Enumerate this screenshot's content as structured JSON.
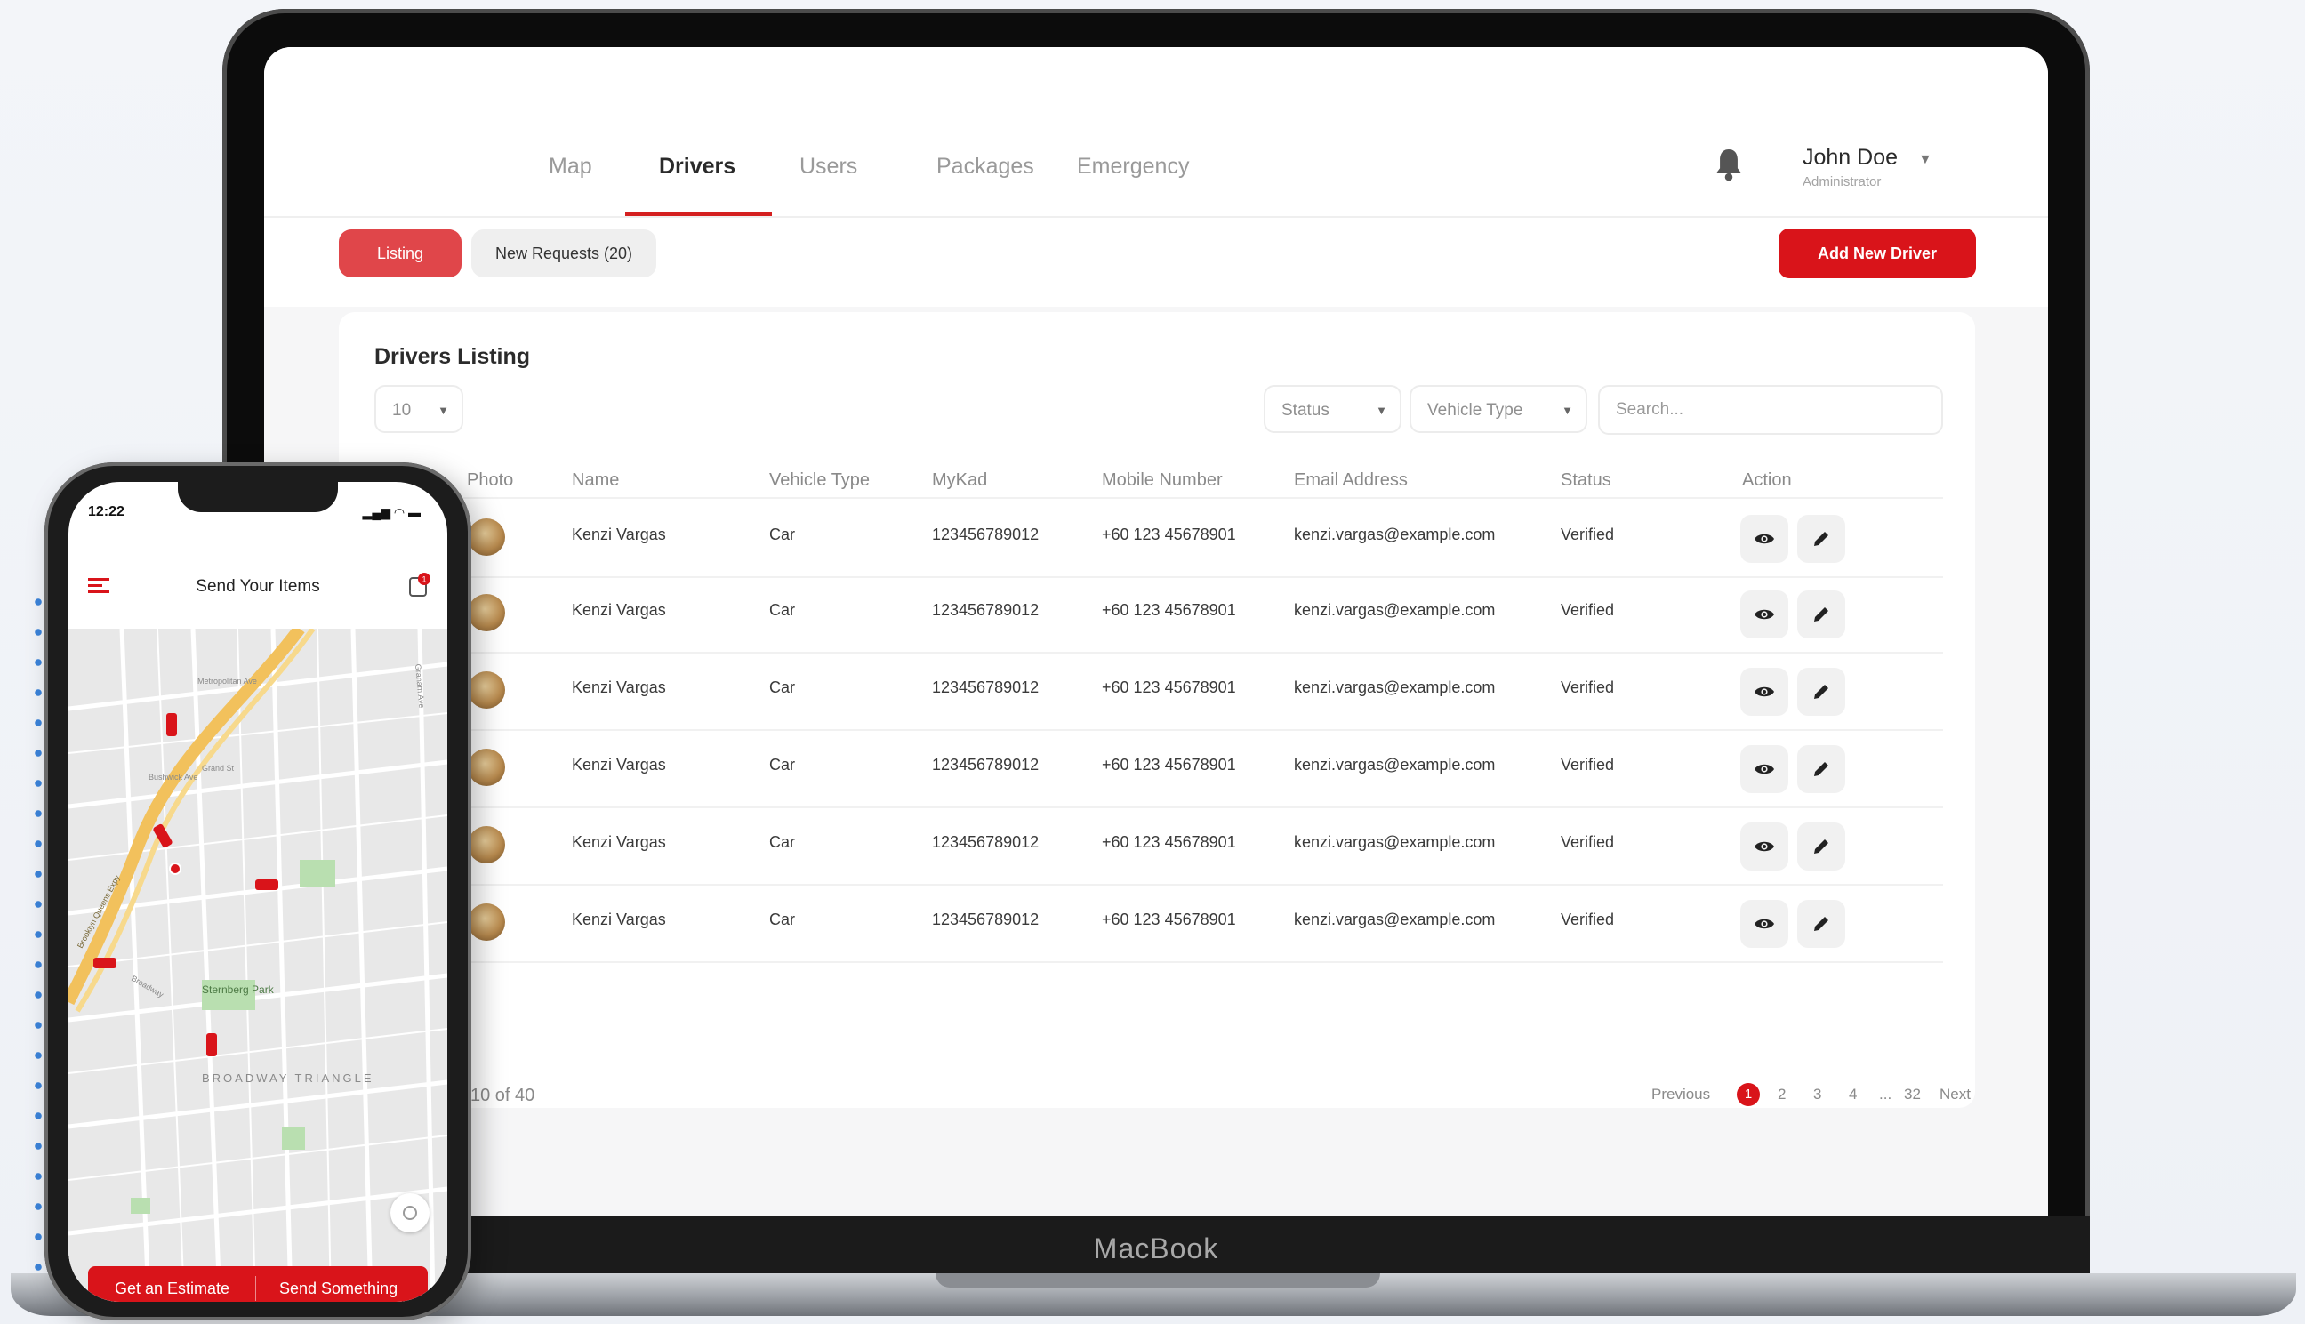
{
  "nav": {
    "tabs": [
      {
        "label": "Map"
      },
      {
        "label": "Drivers"
      },
      {
        "label": "Users"
      },
      {
        "label": "Packages"
      },
      {
        "label": "Emergency"
      }
    ],
    "active_tab": "Drivers",
    "user": {
      "name": "John Doe",
      "role": "Administrator"
    }
  },
  "subbar": {
    "listing_label": "Listing",
    "requests_label": "New Requests (20)",
    "add_label": "Add New Driver"
  },
  "listing": {
    "title": "Drivers Listing",
    "page_size": "10",
    "status_filter": "Status",
    "vehicle_filter": "Vehicle Type",
    "search_placeholder": "Search...",
    "columns": [
      "Photo",
      "Name",
      "Vehicle Type",
      "MyKad",
      "Mobile Number",
      "Email Address",
      "Status",
      "Action"
    ],
    "rows": [
      {
        "name": "Kenzi Vargas",
        "vehicle": "Car",
        "mykad": "123456789012",
        "mobile": "+60 123 45678901",
        "email": "kenzi.vargas@example.com",
        "status": "Verified"
      },
      {
        "name": "Kenzi Vargas",
        "vehicle": "Car",
        "mykad": "123456789012",
        "mobile": "+60 123 45678901",
        "email": "kenzi.vargas@example.com",
        "status": "Verified"
      },
      {
        "name": "Kenzi Vargas",
        "vehicle": "Car",
        "mykad": "123456789012",
        "mobile": "+60 123 45678901",
        "email": "kenzi.vargas@example.com",
        "status": "Verified"
      },
      {
        "name": "Kenzi Vargas",
        "vehicle": "Car",
        "mykad": "123456789012",
        "mobile": "+60 123 45678901",
        "email": "kenzi.vargas@example.com",
        "status": "Verified"
      },
      {
        "name": "Kenzi Vargas",
        "vehicle": "Car",
        "mykad": "123456789012",
        "mobile": "+60 123 45678901",
        "email": "kenzi.vargas@example.com",
        "status": "Verified"
      },
      {
        "name": "Kenzi Vargas",
        "vehicle": "Car",
        "mykad": "123456789012",
        "mobile": "+60 123 45678901",
        "email": "kenzi.vargas@example.com",
        "status": "Verified"
      }
    ],
    "count_text": "10 of 40",
    "pagination": {
      "previous": "Previous",
      "pages": [
        "1",
        "2",
        "3",
        "4",
        "...",
        "32"
      ],
      "current": "1",
      "next": "Next"
    }
  },
  "device": {
    "laptop_brand": "MacBook"
  },
  "phone": {
    "time": "12:22",
    "title": "Send Your Items",
    "badge": "1",
    "map_labels": [
      "Sternberg Park",
      "BROADWAY TRIANGLE",
      "Metropolitan Ave",
      "Grand St",
      "Broadway",
      "Brooklyn Queens Expy",
      "Bushwick Ave",
      "Graham Ave"
    ],
    "estimate_label": "Get an Estimate",
    "send_label": "Send Something"
  },
  "colors": {
    "accent": "#d9141a",
    "listing_button": "#e0464a",
    "dots": "#3b83d9"
  }
}
